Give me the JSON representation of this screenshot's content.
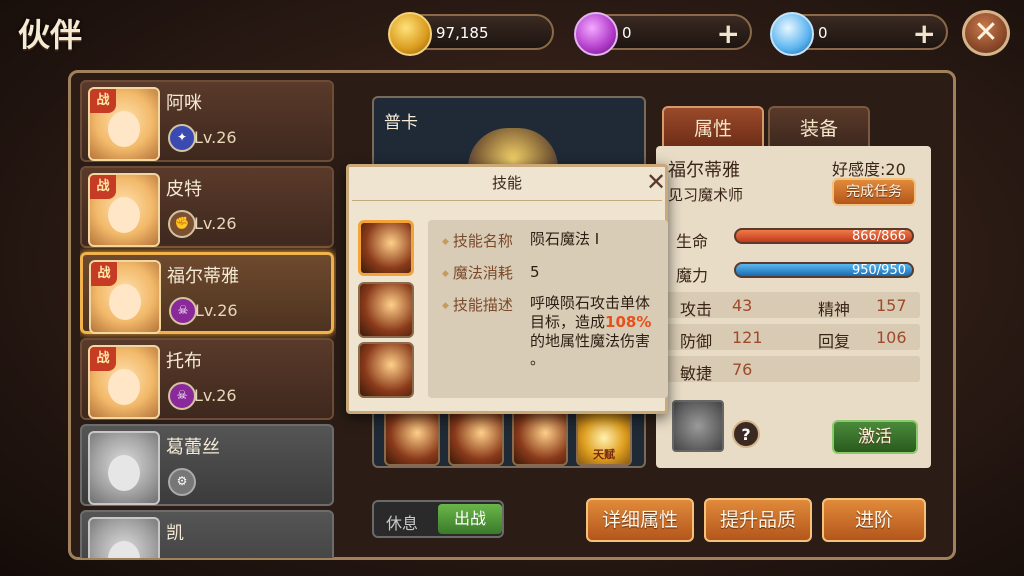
{
  "header": {
    "title": "伙伴"
  },
  "currencies": [
    {
      "icon": "gold-coin-icon",
      "value": "97,185"
    },
    {
      "icon": "purple-gem-icon",
      "value": "0",
      "add": "+"
    },
    {
      "icon": "diamond-icon",
      "value": "0",
      "add": "+"
    }
  ],
  "close_label": "✕",
  "companions": [
    {
      "badge": "战",
      "name": "阿咪",
      "level": "Lv.26",
      "element": "wind-element-icon"
    },
    {
      "badge": "战",
      "name": "皮特",
      "level": "Lv.26",
      "element": "earth-element-icon"
    },
    {
      "badge": "战",
      "name": "福尔蒂雅",
      "level": "Lv.26",
      "element": "dark-element-icon",
      "selected": true
    },
    {
      "badge": "战",
      "name": "托布",
      "level": "Lv.26",
      "element": "dark-element-icon"
    },
    {
      "name": "葛蕾丝",
      "locked": true
    },
    {
      "name": "凯",
      "locked": true
    }
  ],
  "stage": {
    "name": "普卡",
    "talent_label": "天赋"
  },
  "tabs": {
    "attributes": "属性",
    "equipment": "装备"
  },
  "hero": {
    "name": "福尔蒂雅",
    "class": "见习魔术师",
    "affinity": "好感度:20",
    "task_button": "完成任务",
    "hp_label": "生命",
    "hp": "866/866",
    "hp_fraction": 1.0,
    "mp_label": "魔力",
    "mp": "950/950",
    "mp_fraction": 1.0,
    "stats": [
      {
        "label": "攻击",
        "value": "43"
      },
      {
        "label": "精神",
        "value": "157"
      },
      {
        "label": "防御",
        "value": "121"
      },
      {
        "label": "回复",
        "value": "106"
      },
      {
        "label": "敏捷",
        "value": "76"
      }
    ],
    "help": "?",
    "activate": "激活"
  },
  "toggle": {
    "rest": "休息",
    "battle": "出战"
  },
  "actions": {
    "detail": "详细属性",
    "quality": "提升品质",
    "advance": "进阶"
  },
  "popup": {
    "title": "技能",
    "close": "✕",
    "name_label": "技能名称",
    "name": "陨石魔法 Ⅰ",
    "cost_label": "魔法消耗",
    "cost": "5",
    "desc_label": "技能描述",
    "desc_1": "呼唤陨石攻击单体",
    "desc_2a": "目标，造成",
    "desc_2b": "108%",
    "desc_3": "的地属性魔法伤害",
    "desc_4": "。"
  },
  "colors": {
    "accent": "#f2a43a",
    "hp": "#e04a2a",
    "mp": "#2a8ad0",
    "highlight": "#e8501a"
  }
}
